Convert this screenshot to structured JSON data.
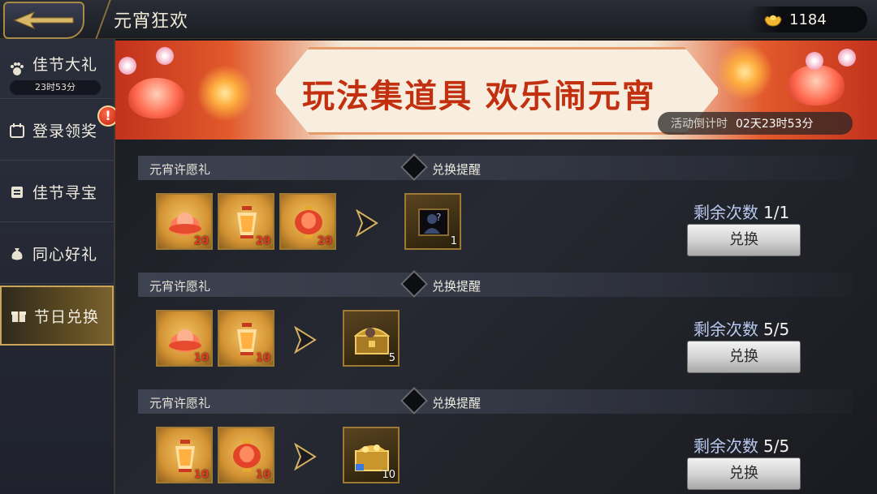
{
  "header": {
    "title": "元宵狂欢",
    "currency_value": "1184"
  },
  "sidebar": {
    "items": [
      {
        "label": "佳节大礼",
        "timer": "23时53分"
      },
      {
        "label": "登录领奖",
        "badge": "!"
      },
      {
        "label": "佳节寻宝"
      },
      {
        "label": "同心好礼"
      },
      {
        "label": "节日兑换"
      }
    ]
  },
  "banner": {
    "title": "玩法集道具 欢乐闹元宵",
    "countdown_label": "活动倒计时",
    "countdown_value": "02天23时53分"
  },
  "rows": [
    {
      "name": "元宵许愿礼",
      "remind_label": "兑换提醒",
      "inputs": [
        {
          "icon": "lotus-lantern-icon",
          "count": "20"
        },
        {
          "icon": "palace-lantern-icon",
          "count": "20"
        },
        {
          "icon": "red-lantern-icon",
          "count": "20"
        }
      ],
      "reward": {
        "icon": "mystery-scroll-icon",
        "count": "1"
      },
      "remain_label": "剩余次数",
      "remain_value": "1/1",
      "button_label": "兑换"
    },
    {
      "name": "元宵许愿礼",
      "remind_label": "兑换提醒",
      "inputs": [
        {
          "icon": "lotus-lantern-icon",
          "count": "10"
        },
        {
          "icon": "palace-lantern-icon",
          "count": "10"
        }
      ],
      "reward": {
        "icon": "hero-chest-icon",
        "count": "5"
      },
      "remain_label": "剩余次数",
      "remain_value": "5/5",
      "button_label": "兑换"
    },
    {
      "name": "元宵许愿礼",
      "remind_label": "兑换提醒",
      "inputs": [
        {
          "icon": "palace-lantern-icon",
          "count": "10"
        },
        {
          "icon": "red-lantern-icon",
          "count": "10"
        }
      ],
      "reward": {
        "icon": "gold-chest-icon",
        "count": "10"
      },
      "remain_label": "剩余次数",
      "remain_value": "5/5",
      "button_label": "兑换"
    }
  ]
}
